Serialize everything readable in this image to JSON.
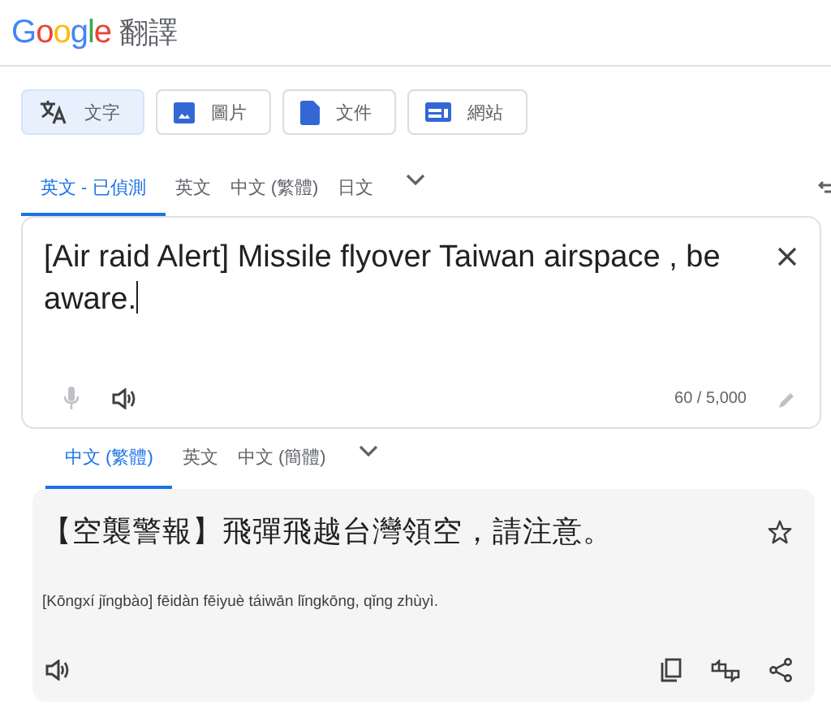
{
  "header": {
    "logo": "Google",
    "title": "翻譯"
  },
  "modes": [
    {
      "label": "文字",
      "kind": "text",
      "selected": true
    },
    {
      "label": "圖片",
      "kind": "image",
      "selected": false
    },
    {
      "label": "文件",
      "kind": "document",
      "selected": false
    },
    {
      "label": "網站",
      "kind": "website",
      "selected": false
    }
  ],
  "source_languages": [
    {
      "label": "英文 - 已偵測",
      "selected": true
    },
    {
      "label": "英文",
      "selected": false
    },
    {
      "label": "中文 (繁體)",
      "selected": false
    },
    {
      "label": "日文",
      "selected": false
    }
  ],
  "source": {
    "value": "[Air raid Alert] Missile flyover Taiwan airspace , be aware.",
    "count": "60 / 5,000"
  },
  "target_languages": [
    {
      "label": "中文 (繁體)",
      "selected": true
    },
    {
      "label": "英文",
      "selected": false
    },
    {
      "label": "中文 (簡體)",
      "selected": false
    }
  ],
  "result": {
    "text": "【空襲警報】飛彈飛越台灣領空，請注意。",
    "romanization": "[Kōngxí jǐngbào] fēidàn fēiyuè táiwān lǐngkōng, qǐng zhùyì."
  }
}
